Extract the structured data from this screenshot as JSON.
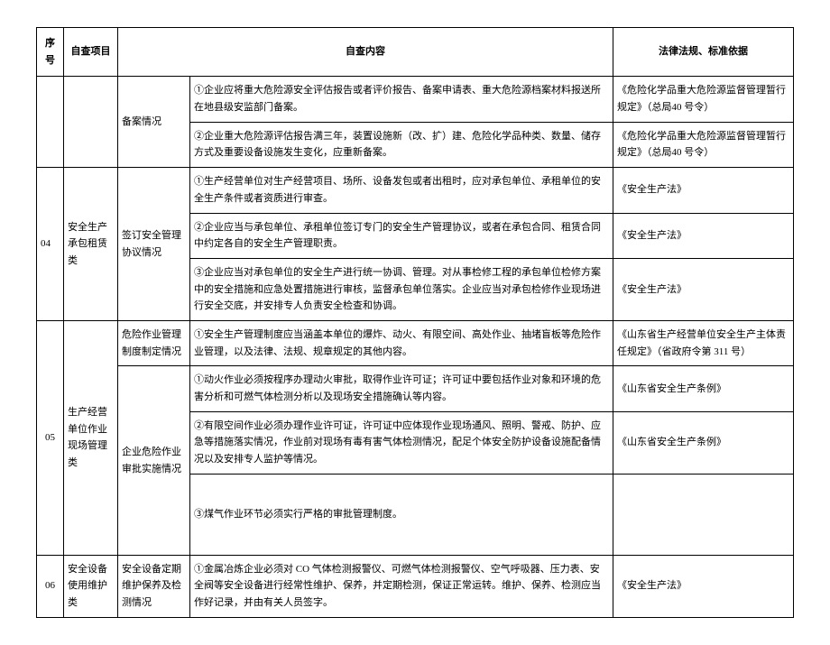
{
  "headers": {
    "seq": "序号",
    "project": "自查项目",
    "content": "自查内容",
    "basis": "法律法规、标准依据"
  },
  "rows": [
    {
      "seq": "",
      "project": "",
      "sub": "备案情况",
      "cells": [
        {
          "content": "①企业应将重大危险源安全评估报告或者评价报告、备案申请表、重大危险源档案材料报送所在地县级安监部门备案。",
          "basis": "《危险化学品重大危险源监督管理暂行规定》（总局40 号令）"
        },
        {
          "content": "②企业重大危险源评估报告满三年，装置设施新（改、扩）建、危险化学品种类、数量、储存方式及重要设备设施发生变化，应重新备案。",
          "basis": "《危险化学品重大危险源监督管理暂行规定》（总局40 号令）"
        }
      ]
    },
    {
      "seq": "04",
      "project": "安全生产承包租赁类",
      "sub": "签订安全管理协议情况",
      "cells": [
        {
          "content": "①生产经营单位对生产经营项目、场所、设备发包或者出租时，应对承包单位、承租单位的安全生产条件或者资质进行审查。",
          "basis": "《安全生产法》"
        },
        {
          "content": "②企业应当与承包单位、承租单位签订专门的安全生产管理协议，或者在承包合同、租赁合同中约定各自的安全生产管理职责。",
          "basis": "《安全生产法》"
        },
        {
          "content": "③企业应当对承包单位的安全生产进行统一协调、管理。对从事检修工程的承包单位检修方案中的安全措施和应急处置措施进行审核，监督承包单位落实。企业应当对承包检修作业现场进行安全交底，并安排专人负责安全检查和协调。",
          "basis": "《安全生产法》"
        }
      ]
    },
    {
      "seq": "05",
      "project": "生产经营单位作业现场管理类",
      "subs": [
        {
          "sub": "危险作业管理制度制定情况",
          "cells": [
            {
              "content": "①安全生产管理制度应当涵盖本单位的爆炸、动火、有限空间、高处作业、抽堵盲板等危险作业管理，以及法律、法规、规章规定的其他内容。",
              "basis": "《山东省生产经营单位安全生产主体责任规定》（省政府令第 311 号）"
            }
          ]
        },
        {
          "sub": "企业危险作业审批实施情况",
          "cells": [
            {
              "content": "①动火作业必须按程序办理动火审批，取得作业许可证；许可证中要包括作业对象和环境的危害分析和可燃气体检测分析以及现场安全措施确认等内容。",
              "basis": "《山东省安全生产条例》"
            },
            {
              "content": "②有限空间作业必须办理作业许可证，许可证中应体现作业现场通风、照明、警戒、防护、应急等措施落实情况，作业前对现场有毒有害气体检测情况，配足个体安全防护设备设施配备情况以及安排专人监护等情况。",
              "basis": "《山东省安全生产条例》"
            },
            {
              "content": "③煤气作业环节必须实行严格的审批管理制度。",
              "basis": ""
            }
          ]
        }
      ]
    },
    {
      "seq": "06",
      "project": "安全设备使用维护类",
      "sub": "安全设备定期维护保养及检测情况",
      "cells": [
        {
          "content": "①金属冶炼企业必须对 CO 气体检测报警仪、可燃气体检测报警仪、空气呼吸器、压力表、安全阀等安全设备进行经常性维护、保养，并定期检测，保证正常运转。维护、保养、检测应当作好记录，并由有关人员签字。",
          "basis": "《安全生产法》"
        }
      ]
    }
  ]
}
